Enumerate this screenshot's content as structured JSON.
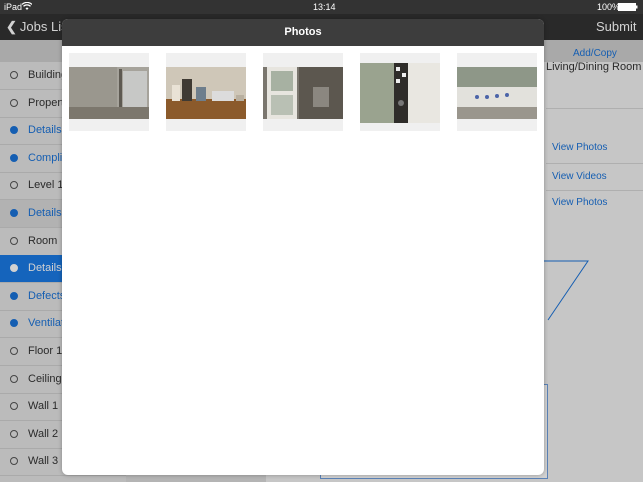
{
  "status_bar": {
    "device": "iPad",
    "time": "13:14",
    "battery": "100%"
  },
  "nav": {
    "back_label": "Jobs List",
    "submit_label": "Submit"
  },
  "sidebar": {
    "items": [
      {
        "label": "Building",
        "state": "empty"
      },
      {
        "label": "Property",
        "state": "empty"
      },
      {
        "label": "Details",
        "state": "done"
      },
      {
        "label": "Compliance",
        "state": "done"
      },
      {
        "label": "Level 1",
        "state": "empty"
      },
      {
        "label": "Details",
        "state": "done-light"
      },
      {
        "label": "Room",
        "state": "empty"
      },
      {
        "label": "Details",
        "state": "active"
      },
      {
        "label": "Defects",
        "state": "done"
      },
      {
        "label": "Ventilation",
        "state": "done"
      },
      {
        "label": "Floor 1",
        "state": "empty"
      },
      {
        "label": "Ceiling",
        "state": "empty"
      },
      {
        "label": "Wall 1",
        "state": "empty"
      },
      {
        "label": "Wall 2",
        "state": "empty"
      },
      {
        "label": "Wall 3",
        "state": "empty"
      }
    ]
  },
  "right_panel": {
    "add_copy_label": "Add/Copy",
    "room_name": "Living/Dining Room",
    "links": [
      "View Photos",
      "View Videos",
      "View Photos"
    ]
  },
  "modal": {
    "title": "Photos",
    "photos": [
      {
        "icon": "window-sill-photo"
      },
      {
        "icon": "desk-photo"
      },
      {
        "icon": "window-photo"
      },
      {
        "icon": "door-frame-photo"
      },
      {
        "icon": "window-control-photo"
      }
    ]
  },
  "colors": {
    "accent": "#1a73d9",
    "active_row": "#1a7ae6",
    "nav_bg": "#333333",
    "modal_header": "#3d3d3d"
  }
}
